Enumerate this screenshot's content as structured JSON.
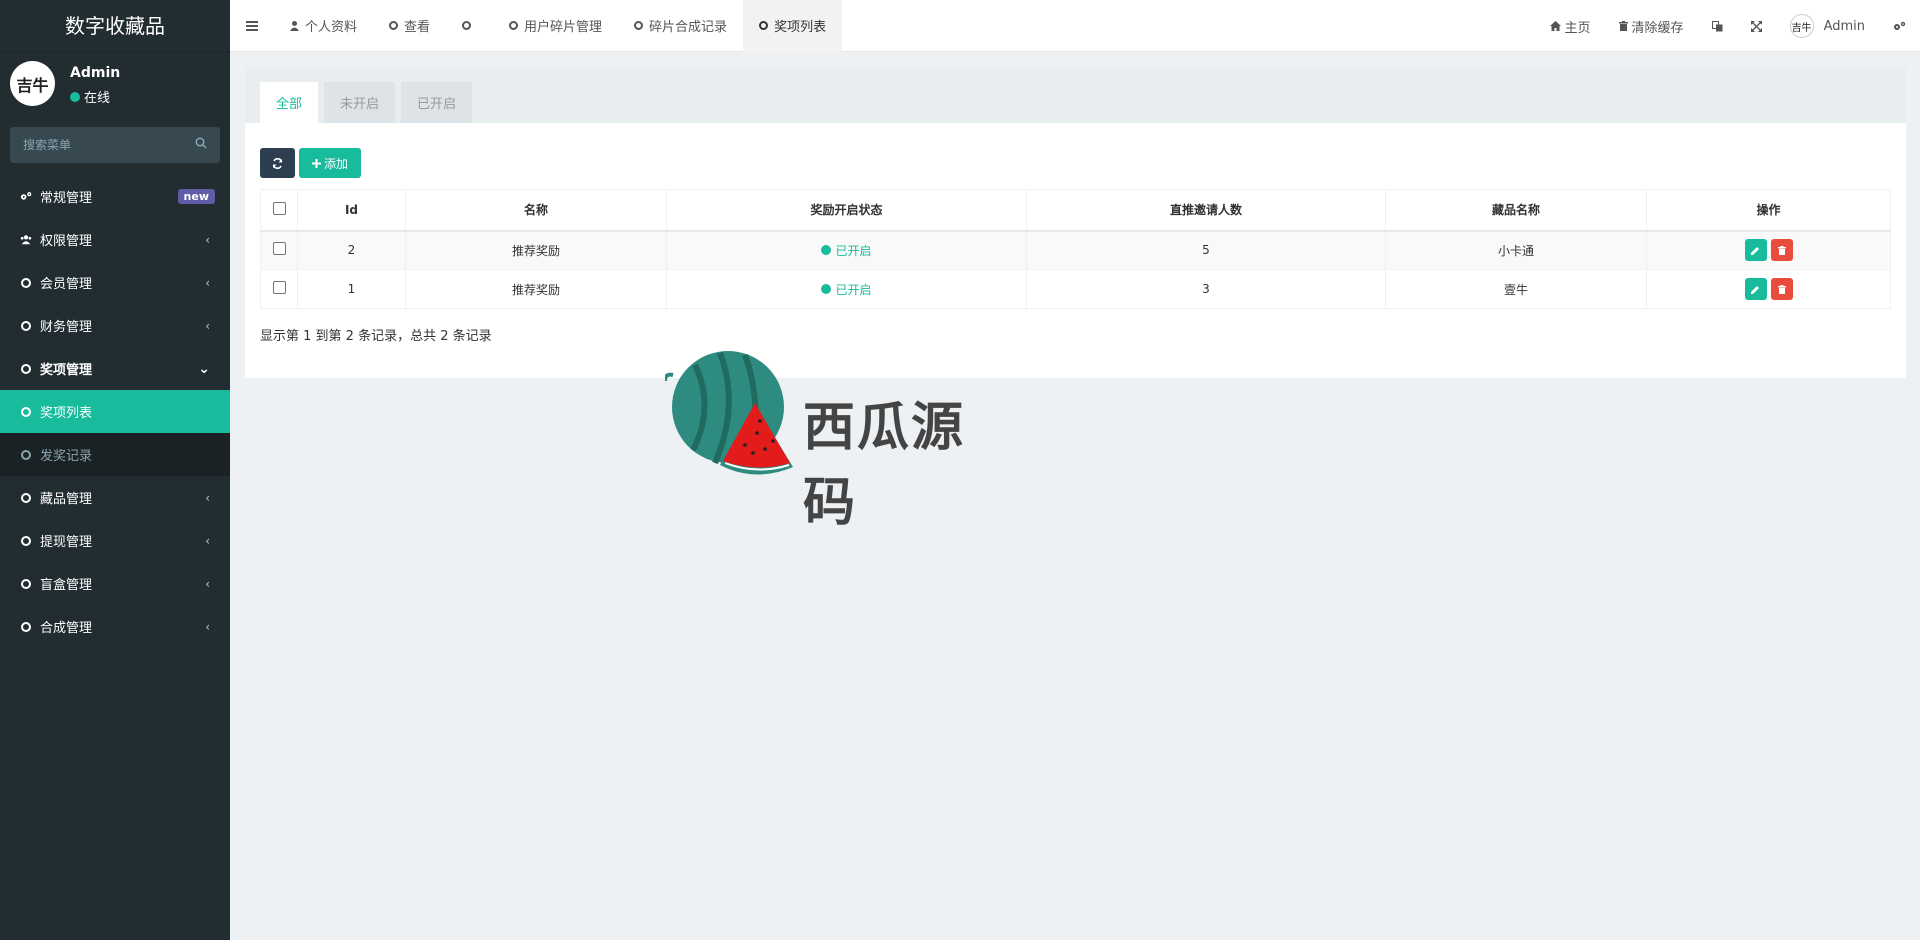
{
  "sidebar": {
    "brand": "数字收藏品",
    "user": {
      "name": "Admin",
      "status": "在线",
      "avatar_text": "吉牛"
    },
    "search_placeholder": "搜索菜单",
    "items": [
      {
        "label": "常规管理",
        "icon": "gears-icon",
        "badge": "new"
      },
      {
        "label": "权限管理",
        "icon": "users-icon",
        "chevron": "‹"
      },
      {
        "label": "会员管理",
        "icon": "circle-icon",
        "chevron": "‹"
      },
      {
        "label": "财务管理",
        "icon": "circle-icon",
        "chevron": "‹"
      },
      {
        "label": "奖项管理",
        "icon": "circle-icon",
        "chevron": "⌄"
      },
      {
        "label": "奖项列表",
        "icon": "circle-icon"
      },
      {
        "label": "发奖记录",
        "icon": "circle-icon"
      },
      {
        "label": "藏品管理",
        "icon": "circle-icon",
        "chevron": "‹"
      },
      {
        "label": "提现管理",
        "icon": "circle-icon",
        "chevron": "‹"
      },
      {
        "label": "盲盒管理",
        "icon": "circle-icon",
        "chevron": "‹"
      },
      {
        "label": "合成管理",
        "icon": "circle-icon",
        "chevron": "‹"
      }
    ]
  },
  "navbar": {
    "toggle_icon": "bars-icon",
    "tabs": [
      {
        "label": "个人资料",
        "icon": "user-icon"
      },
      {
        "label": "查看",
        "icon": "circle-icon"
      },
      {
        "label": "",
        "icon": "circle-icon"
      },
      {
        "label": "用户碎片管理",
        "icon": "circle-icon"
      },
      {
        "label": "碎片合成记录",
        "icon": "circle-icon"
      },
      {
        "label": "奖项列表",
        "icon": "circle-icon",
        "active": true
      }
    ],
    "right": {
      "home": "主页",
      "clear_cache": "清除缓存",
      "user": "Admin",
      "avatar_text": "吉牛"
    }
  },
  "content": {
    "filter_tabs": [
      "全部",
      "未开启",
      "已开启"
    ],
    "toolbar": {
      "add_label": "添加"
    },
    "table": {
      "columns": [
        "Id",
        "名称",
        "奖励开启状态",
        "直推邀请人数",
        "藏品名称",
        "操作"
      ],
      "rows": [
        {
          "id": "2",
          "name": "推荐奖励",
          "status": "已开启",
          "invites": "5",
          "collection": "小卡通"
        },
        {
          "id": "1",
          "name": "推荐奖励",
          "status": "已开启",
          "invites": "3",
          "collection": "壹牛"
        }
      ]
    },
    "pagination_info": "显示第 1 到第 2 条记录，总共 2 条记录"
  },
  "watermark": {
    "text": "西瓜源码"
  },
  "colors": {
    "accent": "#18bc9c",
    "danger": "#e74c3c",
    "sidebar": "#222d32",
    "dark_button": "#2c3e50",
    "badge": "#605ca8"
  }
}
